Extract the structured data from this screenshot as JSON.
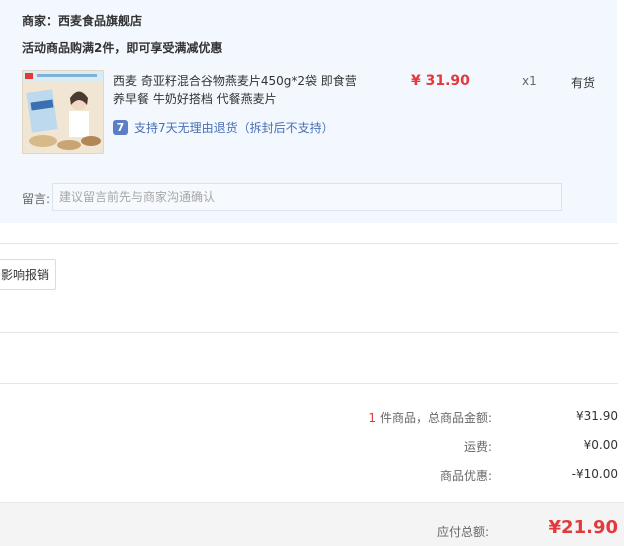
{
  "order": {
    "merchant_label": "商家：西麦食品旗舰店",
    "promo_text": "活动商品购满2件，即可享受满减优惠",
    "product": {
      "title": "西麦 奇亚籽混合谷物燕麦片450g*2袋 即食营养早餐 牛奶好搭档 代餐燕麦片",
      "price": "¥ 31.90",
      "quantity": "x1",
      "stock": "有货",
      "return_badge": "7",
      "return_text": "支持7天无理由退货（拆封后不支持）"
    },
    "remark": {
      "label": "留言:",
      "placeholder": "建议留言前先与商家沟通确认"
    }
  },
  "invoice": {
    "button_label": "影响报销"
  },
  "summary": {
    "count": "1",
    "goods_total_label": "件商品，总商品金额:",
    "goods_total_value": "¥31.90",
    "shipping_label": "运费:",
    "shipping_value": "¥0.00",
    "discount_label": "商品优惠:",
    "discount_value": "-¥10.00"
  },
  "total": {
    "label": "应付总额:",
    "value": "¥21.90"
  },
  "colors": {
    "accent_red": "#e4393c",
    "link_blue": "#4a6fb5",
    "panel_bg": "#f2f8fe"
  }
}
